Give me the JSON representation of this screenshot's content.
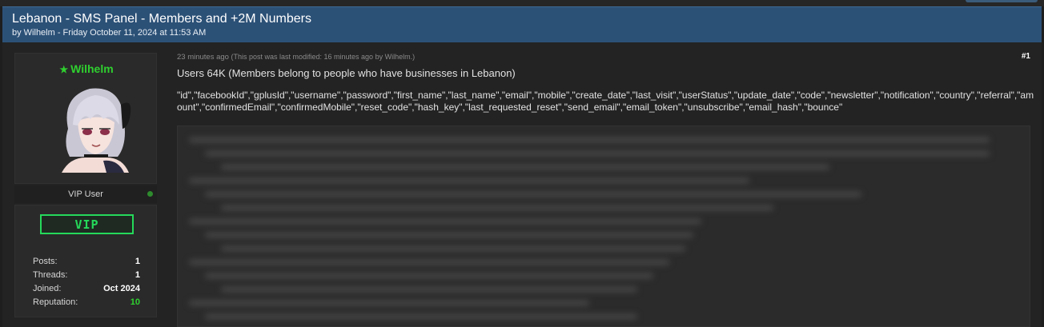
{
  "thread": {
    "title": "Lebanon - SMS Panel - Members and +2M Numbers",
    "meta": "by Wilhelm - Friday October 11, 2024 at 11:53 AM"
  },
  "author": {
    "name": "Wilhelm",
    "user_title": "VIP User",
    "badge": "VIP",
    "stats": [
      {
        "label": "Posts:",
        "value": "1"
      },
      {
        "label": "Threads:",
        "value": "1"
      },
      {
        "label": "Joined:",
        "value": "Oct 2024"
      },
      {
        "label": "Reputation:",
        "value": "10"
      }
    ],
    "online": true
  },
  "post": {
    "time": "23 minutes ago",
    "modified": "(This post was last modified: 16 minutes ago by Wilhelm.)",
    "number": "#1",
    "line1": "Users 64K  (Members belong to people who have businesses in Lebanon)",
    "fields": "\"id\",\"facebookId\",\"gplusId\",\"username\",\"password\",\"first_name\",\"last_name\",\"email\",\"mobile\",\"create_date\",\"last_visit\",\"userStatus\",\"update_date\",\"code\",\"newsletter\",\"notification\",\"country\",\"referral\",\"amount\",\"confirmedEmail\",\"confirmedMobile\",\"reset_code\",\"hash_key\",\"last_requested_reset\",\"send_email\",\"email_token\",\"unsubscribe\",\"email_hash\",\"bounce\""
  },
  "colors": {
    "header_bg": "#2c5177",
    "accent_green": "#2fd02f",
    "vip_green": "#25d95a",
    "page_bg": "#1e1e1e"
  },
  "icons": {
    "name_star": "star-icon",
    "online": "online-status-icon"
  }
}
